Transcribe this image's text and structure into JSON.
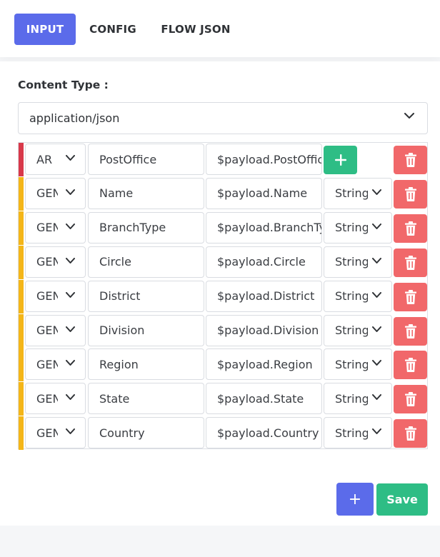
{
  "tabs": [
    {
      "label": "INPUT",
      "active": true
    },
    {
      "label": "CONFIG",
      "active": false
    },
    {
      "label": "FLOW JSON",
      "active": false
    }
  ],
  "content_type": {
    "label": "Content Type :",
    "value": "application/json"
  },
  "mappings": [
    {
      "kind": "AR",
      "name": "PostOffice",
      "path": "$payload.PostOffice",
      "type": null,
      "stripe_color": "#d8394a"
    },
    {
      "kind": "GEN",
      "name": "Name",
      "path": "$payload.Name",
      "type": "String",
      "stripe_color": "#f4b619"
    },
    {
      "kind": "GEN",
      "name": "BranchType",
      "path": "$payload.BranchType",
      "type": "String",
      "stripe_color": "#f4b619"
    },
    {
      "kind": "GEN",
      "name": "Circle",
      "path": "$payload.Circle",
      "type": "String",
      "stripe_color": "#f4b619"
    },
    {
      "kind": "GEN",
      "name": "District",
      "path": "$payload.District",
      "type": "String",
      "stripe_color": "#f4b619"
    },
    {
      "kind": "GEN",
      "name": "Division",
      "path": "$payload.Division",
      "type": "String",
      "stripe_color": "#f4b619"
    },
    {
      "kind": "GEN",
      "name": "Region",
      "path": "$payload.Region",
      "type": "String",
      "stripe_color": "#f4b619"
    },
    {
      "kind": "GEN",
      "name": "State",
      "path": "$payload.State",
      "type": "String",
      "stripe_color": "#f4b619"
    },
    {
      "kind": "GEN",
      "name": "Country",
      "path": "$payload.Country",
      "type": "String",
      "stripe_color": "#f4b619"
    }
  ],
  "actions": {
    "add_label": "+",
    "save_label": "Save"
  },
  "colors": {
    "primary": "#5b6bea",
    "success": "#2ebd85",
    "danger": "#f1686a",
    "array_stripe": "#d8394a",
    "general_stripe": "#f4b619"
  },
  "icons": {
    "add_row": "plus-icon",
    "delete": "trash-icon",
    "dropdown": "chevron-down-icon"
  }
}
